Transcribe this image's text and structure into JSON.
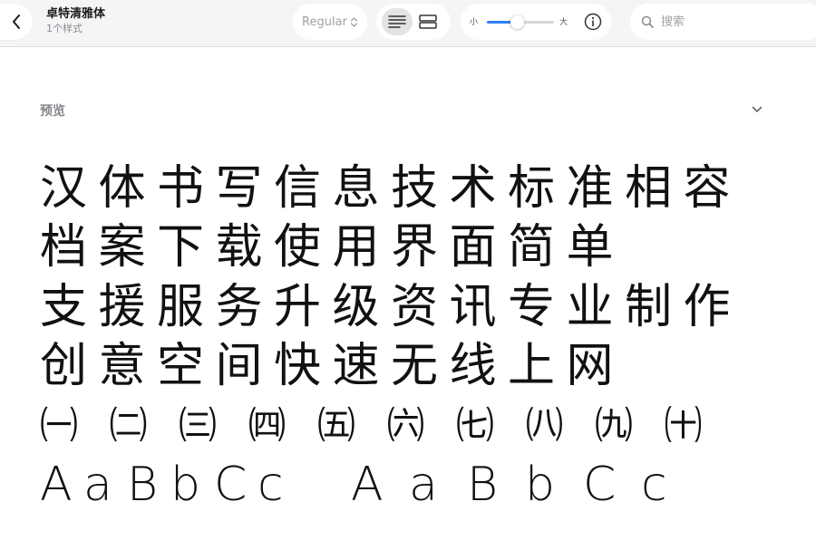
{
  "header": {
    "title": "卓特清雅体",
    "subtitle": "1个样式"
  },
  "toolbar": {
    "weight": "Regular",
    "view_modes": [
      "list-view-icon",
      "grid-view-icon"
    ],
    "active_view": "list-view-icon",
    "size_small_label": "小",
    "size_large_label": "大",
    "size_slider_value": 0.45,
    "search_placeholder": "搜索"
  },
  "preview": {
    "label": "预览",
    "lines": [
      [
        "汉",
        "体",
        "书",
        "写",
        "信",
        "息",
        "技",
        "术",
        "标",
        "准",
        "相",
        "容"
      ],
      [
        "档",
        "案",
        "下",
        "载",
        "使",
        "用",
        "界",
        "面",
        "简",
        "单"
      ],
      [
        "支",
        "援",
        "服",
        "务",
        "升",
        "级",
        "资",
        "讯",
        "专",
        "业",
        "制",
        "作"
      ],
      [
        "创",
        "意",
        "空",
        "间",
        "快",
        "速",
        "无",
        "线",
        "上",
        "网"
      ]
    ],
    "enclosed_numbers": [
      "㈠",
      "㈡",
      "㈢",
      "㈣",
      "㈤",
      "㈥",
      "㈦",
      "㈧",
      "㈨",
      "㈩"
    ],
    "latin_1": [
      "A",
      "a",
      "B",
      "b",
      "C",
      "c"
    ],
    "latin_2": [
      "A",
      "a",
      "B",
      "b",
      "C",
      "c"
    ]
  },
  "colors": {
    "accent": "#2f7bf5",
    "toolbar_bg": "#f5f5f7",
    "label_gray": "#86868b"
  }
}
